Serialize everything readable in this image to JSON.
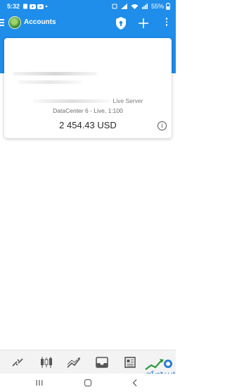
{
  "status_bar": {
    "time": "5:32",
    "battery": "55%"
  },
  "app_bar": {
    "title": "Accounts"
  },
  "account": {
    "server_suffix": "Live Server",
    "datacenter": "DataCenter 6 - Live, 1:100",
    "balance": "2 454.43 USD"
  },
  "bottom_nav": {
    "items": [
      "quotes-icon",
      "chart-icon",
      "trade-icon",
      "history-icon",
      "news-icon"
    ]
  },
  "watermark": {
    "text": "عرب فوركس"
  },
  "colors": {
    "primary": "#1f8dea",
    "card": "#ffffff",
    "nav_bg": "#f3f3f3"
  }
}
